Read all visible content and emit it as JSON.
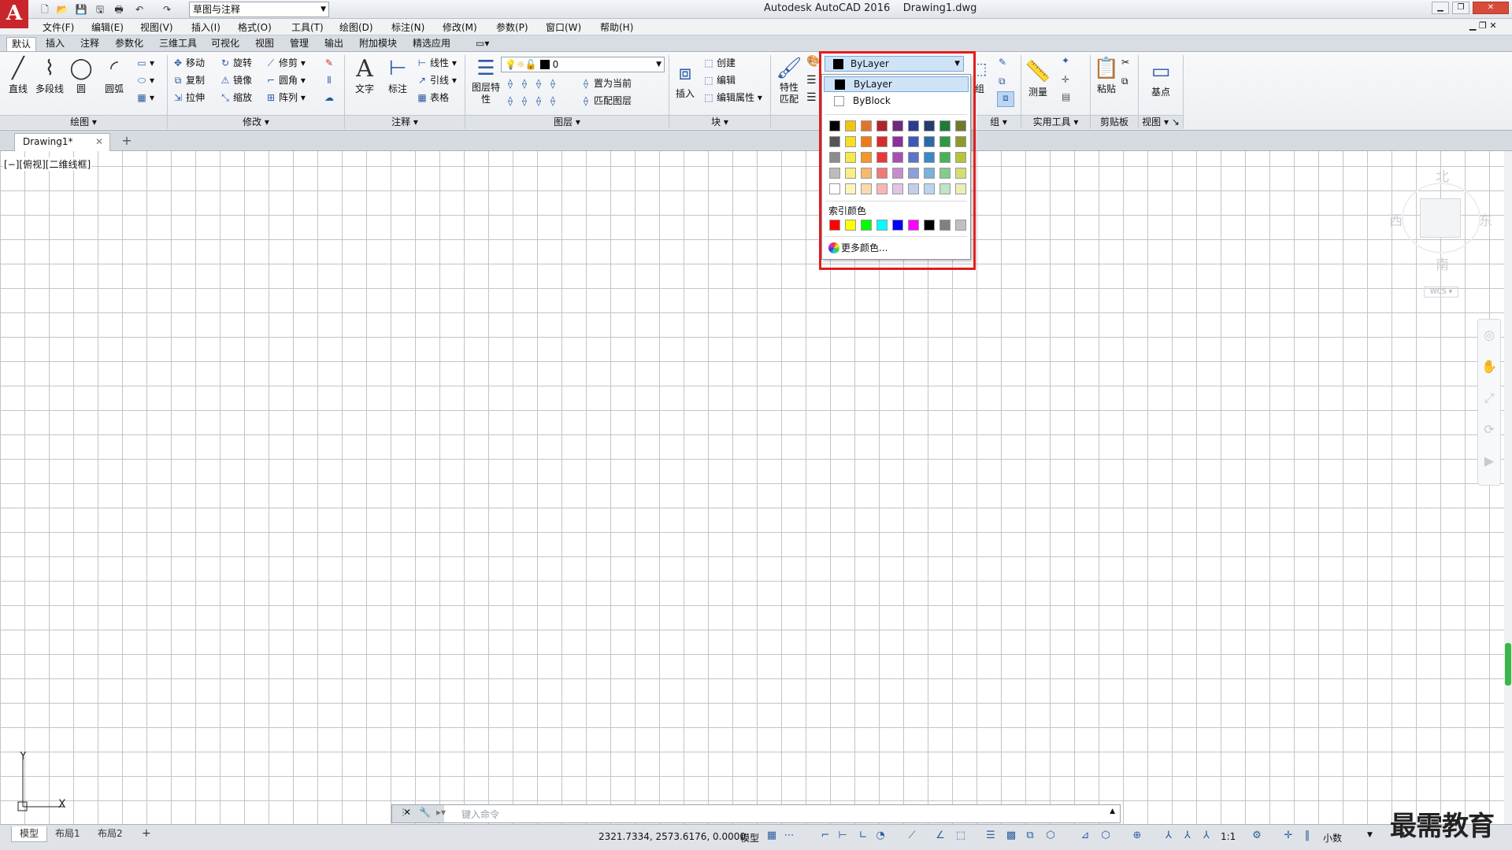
{
  "title_bar": {
    "logo": "A",
    "workspace": "草图与注释",
    "title": "Autodesk AutoCAD 2016    Drawing1.dwg",
    "quick_access_icons": [
      "new-icon",
      "open-icon",
      "save-icon",
      "saveas-icon",
      "print-icon",
      "undo-icon",
      "redo-icon"
    ]
  },
  "menu": [
    "文件(F)",
    "编辑(E)",
    "视图(V)",
    "插入(I)",
    "格式(O)",
    "工具(T)",
    "绘图(D)",
    "标注(N)",
    "修改(M)",
    "参数(P)",
    "窗口(W)",
    "帮助(H)"
  ],
  "ribbon_tabs": [
    "默认",
    "插入",
    "注释",
    "参数化",
    "三维工具",
    "可视化",
    "视图",
    "管理",
    "输出",
    "附加模块",
    "精选应用"
  ],
  "active_tab": "默认",
  "ribbon": {
    "draw": {
      "title": "绘图",
      "tools": [
        "直线",
        "多段线",
        "圆",
        "圆弧"
      ]
    },
    "modify": {
      "title": "修改",
      "tools": [
        "移动",
        "旋转",
        "修剪",
        "复制",
        "镜像",
        "圆角",
        "拉伸",
        "缩放",
        "阵列"
      ]
    },
    "annotation": {
      "title": "注释",
      "tools": [
        "文字",
        "标注",
        "线性",
        "引线",
        "表格"
      ]
    },
    "layers": {
      "title": "图层",
      "tools": [
        "图层特性",
        "置为当前",
        "匹配图层"
      ],
      "current_layer": "0"
    },
    "block": {
      "title": "块",
      "tools": [
        "插入",
        "创建",
        "编辑",
        "编辑属性"
      ]
    },
    "properties": {
      "tools": [
        "特性匹配"
      ]
    },
    "groups": {
      "title": "组",
      "tools": [
        "组"
      ]
    },
    "utilities": {
      "title": "实用工具",
      "tools": [
        "测量"
      ]
    },
    "clipboard": {
      "title": "剪贴板",
      "tools": [
        "粘贴"
      ]
    },
    "view": {
      "title": "视图",
      "tools": [
        "基点"
      ]
    }
  },
  "color_dropdown": {
    "selected": "ByLayer",
    "options": [
      "ByLayer",
      "ByBlock"
    ],
    "standard_colors": [
      [
        "#000000",
        "#f2c313",
        "#e0762a",
        "#b0222c",
        "#6d2a7e",
        "#2b3a8f",
        "#253b6d",
        "#1f7a3a",
        "#6f7a2a"
      ],
      [
        "#555555",
        "#f5e020",
        "#f07a1a",
        "#d62c2c",
        "#8d2d9e",
        "#3c58b8",
        "#2b69a8",
        "#2f9a45",
        "#8f9a2a"
      ],
      [
        "#8c8c8c",
        "#f7e84a",
        "#f5962a",
        "#e9383a",
        "#a84fb6",
        "#5c73c8",
        "#3b88c8",
        "#47b355",
        "#b9c23a"
      ],
      [
        "#bcbcbc",
        "#f9ef85",
        "#f8b96a",
        "#f07a7a",
        "#c58ccf",
        "#8e9ed8",
        "#7ab1dd",
        "#84cc8e",
        "#d6de73"
      ],
      [
        "#ffffff",
        "#fbf5bc",
        "#fbd9ad",
        "#f6b6b6",
        "#e1c4e6",
        "#c6cdeb",
        "#b6d6ee",
        "#c0e4c5",
        "#ebefb6"
      ]
    ],
    "index_label": "索引颜色",
    "index_colors": [
      "#ff0000",
      "#ffff00",
      "#00ff00",
      "#00ffff",
      "#0000ff",
      "#ff00ff",
      "#000000",
      "#808080",
      "#c0c0c0"
    ],
    "more_colors": "更多颜色..."
  },
  "document_tab": {
    "name": "Drawing1*"
  },
  "viewport_label": "[−][俯视][二维线框]",
  "viewcube": {
    "north": "北",
    "south": "南",
    "east": "东",
    "west": "西",
    "wcs": "WCS"
  },
  "ucs": {
    "x": "X",
    "y": "Y"
  },
  "command_line": {
    "placeholder": "键入命令"
  },
  "layout_tabs": [
    "模型",
    "布局1",
    "布局2"
  ],
  "status": {
    "coords": "2321.7334, 2573.6176, 0.0000",
    "mode": "模型",
    "scale": "1:1",
    "units": "小数"
  },
  "watermark": "最需教育"
}
